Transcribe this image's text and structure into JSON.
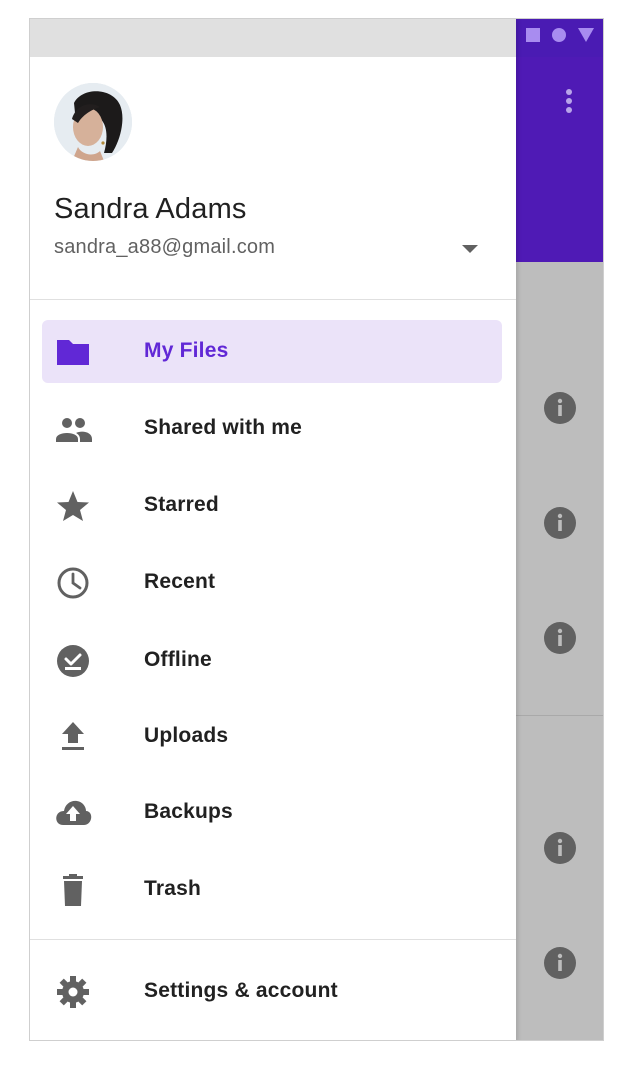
{
  "account": {
    "name": "Sandra Adams",
    "email": "sandra_a88@gmail.com"
  },
  "nav": {
    "items": [
      {
        "label": "My Files",
        "icon": "folder-icon",
        "active": true
      },
      {
        "label": "Shared with me",
        "icon": "people-icon"
      },
      {
        "label": "Starred",
        "icon": "star-icon"
      },
      {
        "label": "Recent",
        "icon": "clock-icon"
      },
      {
        "label": "Offline",
        "icon": "offline-check-icon"
      },
      {
        "label": "Uploads",
        "icon": "upload-icon"
      },
      {
        "label": "Backups",
        "icon": "cloud-upload-icon"
      },
      {
        "label": "Trash",
        "icon": "trash-icon"
      }
    ],
    "settings_label": "Settings & account"
  },
  "colors": {
    "accent": "#6128d6",
    "active_bg": "#ebe3f9",
    "app_bar": "#4f1ab5",
    "scrim": "#bdbdbd",
    "icon": "#616161"
  }
}
